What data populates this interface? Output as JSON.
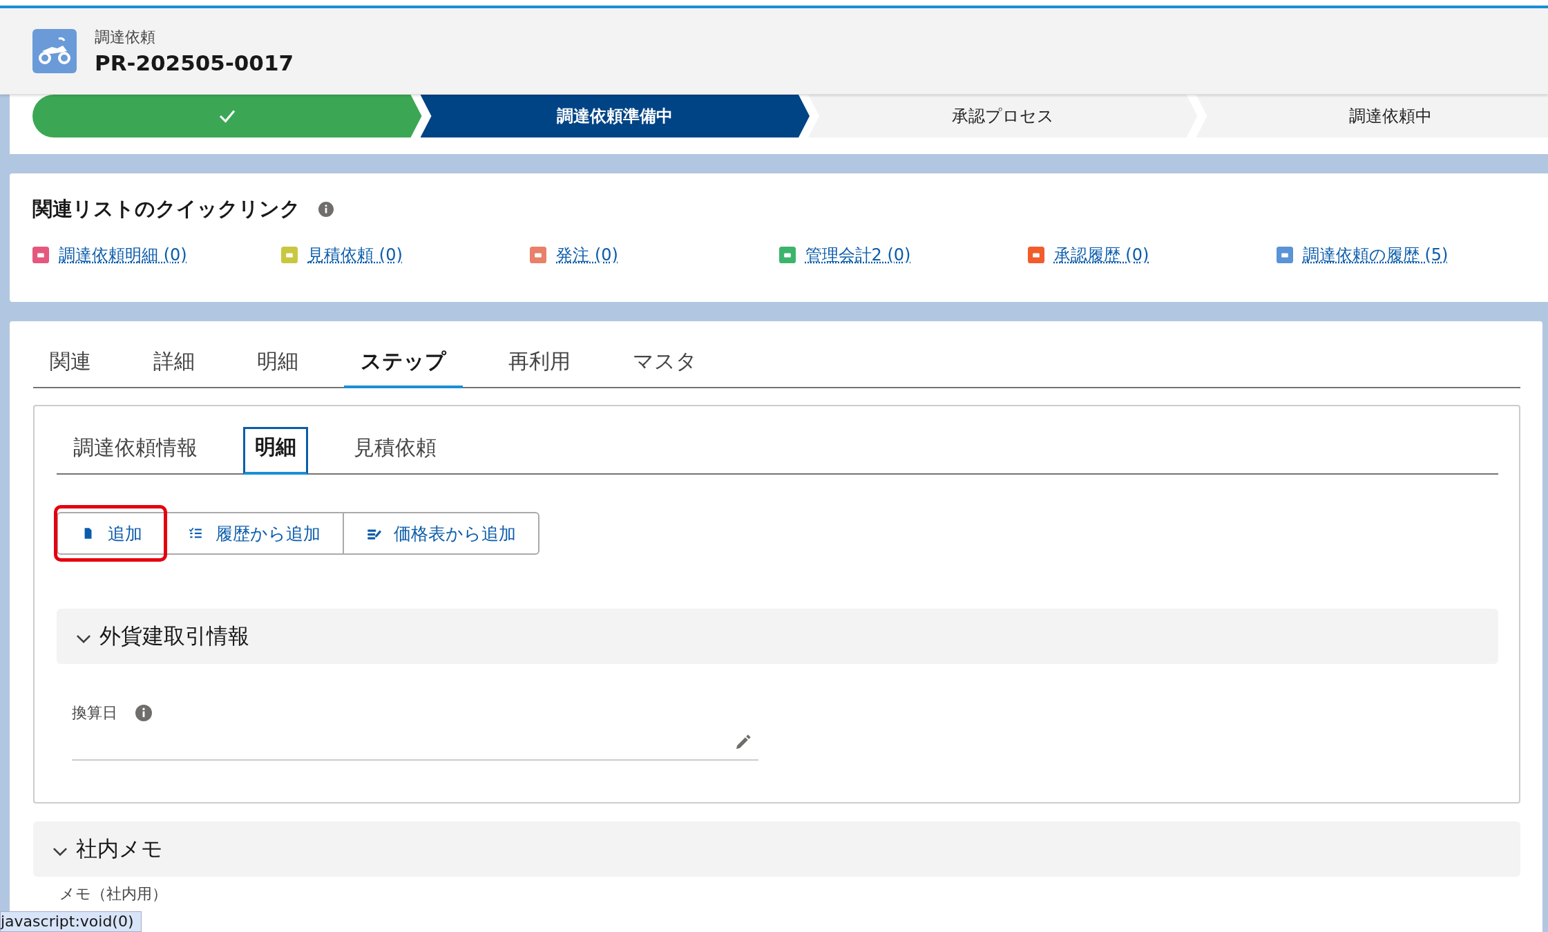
{
  "header": {
    "object_label": "調達依頼",
    "title": "PR-202505-0017"
  },
  "path": [
    {
      "kind": "complete"
    },
    {
      "kind": "current",
      "label": "調達依頼準備中"
    },
    {
      "kind": "incomplete",
      "label": "承認プロセス"
    },
    {
      "kind": "incomplete",
      "label": "調達依頼中"
    }
  ],
  "quick_links": {
    "title": "関連リストのクイックリンク",
    "links": [
      {
        "label": "調達依頼明細 (0)",
        "color": "#e5587d"
      },
      {
        "label": "見積依頼 (0)",
        "color": "#c9c73f"
      },
      {
        "label": "発注 (0)",
        "color": "#e8806a"
      },
      {
        "label": "管理会計2 (0)",
        "color": "#3bb56b"
      },
      {
        "label": "承認履歴 (0)",
        "color": "#f25c2b"
      },
      {
        "label": "調達依頼の履歴 (5)",
        "color": "#5a93d6"
      }
    ]
  },
  "tabs": [
    {
      "label": "関連",
      "selected": false
    },
    {
      "label": "詳細",
      "selected": false
    },
    {
      "label": "明細",
      "selected": false
    },
    {
      "label": "ステップ",
      "selected": true
    },
    {
      "label": "再利用",
      "selected": false
    },
    {
      "label": "マスタ",
      "selected": false
    }
  ],
  "subtabs": [
    {
      "label": "調達依頼情報",
      "selected": false
    },
    {
      "label": "明細",
      "selected": true
    },
    {
      "label": "見積依頼",
      "selected": false
    }
  ],
  "buttons": [
    {
      "label": "追加",
      "highlighted": true
    },
    {
      "label": "履歴から追加",
      "highlighted": false
    },
    {
      "label": "価格表から追加",
      "highlighted": false
    }
  ],
  "sections": [
    {
      "title": "外貨建取引情報",
      "expanded": true,
      "fields": [
        {
          "label": "換算日"
        }
      ]
    }
  ],
  "memo_section": {
    "title": "社内メモ",
    "expanded": true,
    "field_label": "メモ（社内用）"
  },
  "status_tooltip": "javascript:void(0)"
}
